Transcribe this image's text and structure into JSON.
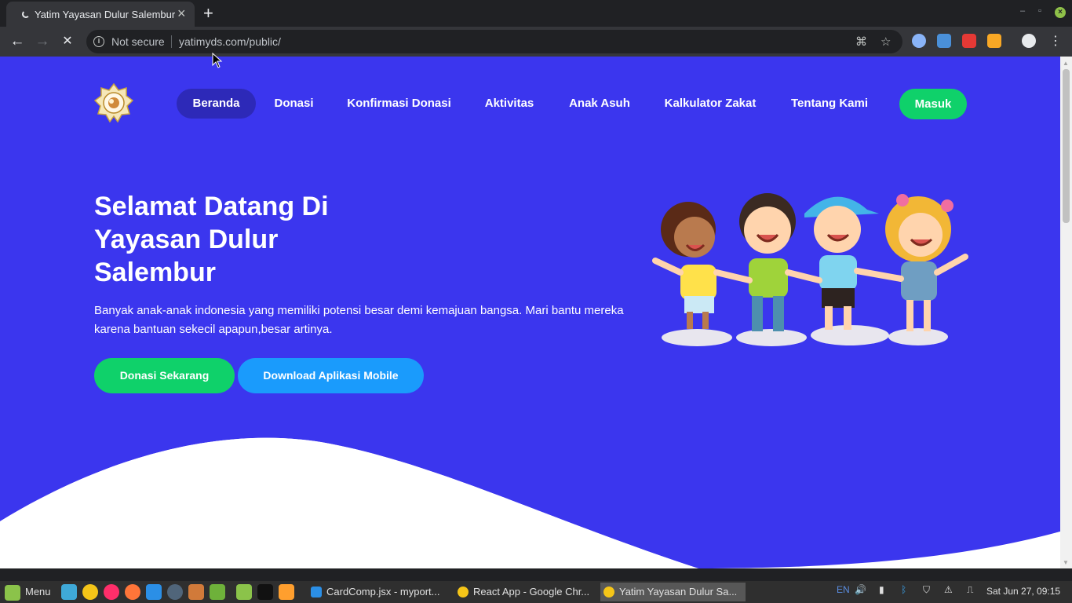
{
  "browser": {
    "tab_title": "Yatim Yayasan Dulur Salembur",
    "new_tab": "+",
    "security_label": "Not secure",
    "url": "yatimyds.com/public/"
  },
  "site": {
    "nav": [
      "Beranda",
      "Donasi",
      "Konfirmasi Donasi",
      "Aktivitas",
      "Anak Asuh",
      "Kalkulator Zakat",
      "Tentang Kami"
    ],
    "login": "Masuk",
    "hero_title": "Selamat Datang Di Yayasan Dulur Salembur",
    "hero_desc": "Banyak anak-anak indonesia yang memiliki potensi besar demi kemajuan bangsa. Mari bantu mereka karena bantuan sekecil apapun,besar artinya.",
    "btn_donate": "Donasi Sekarang",
    "btn_download": "Download Aplikasi Mobile",
    "colors": {
      "hero_bg": "#3b36ee",
      "green": "#0fd16a",
      "blue": "#1a9bfc"
    }
  },
  "taskbar": {
    "menu": "Menu",
    "windows": [
      "CardComp.jsx - myport...",
      "React App - Google Chr...",
      "Yatim Yayasan Dulur Sa..."
    ],
    "lang": "EN",
    "clock": "Sat Jun 27, 09:15"
  }
}
